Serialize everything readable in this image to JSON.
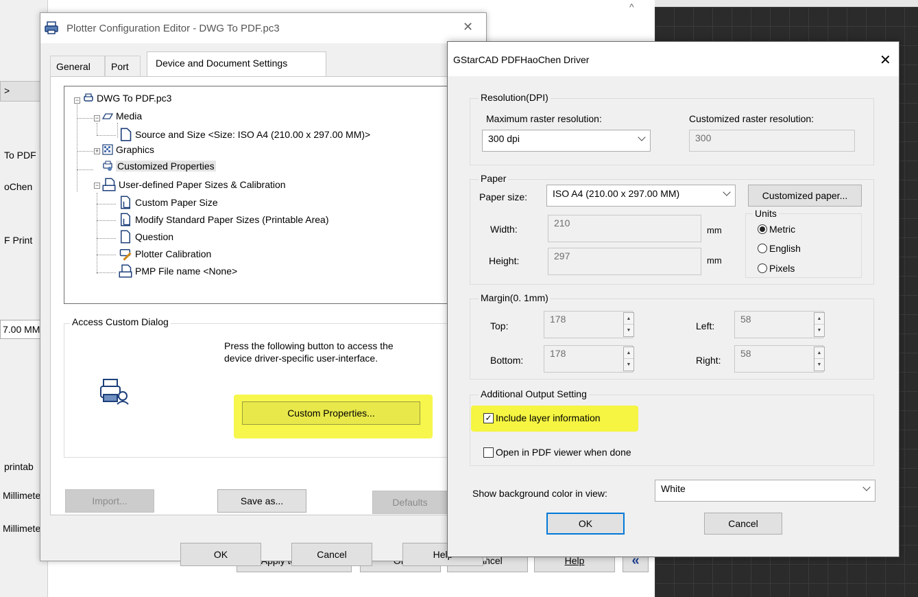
{
  "background_app": {
    "left_fragments": [
      ">",
      "To PDF",
      "oChen",
      "F Print",
      "7.00 MM",
      "printab",
      "Millimete",
      "Millimete"
    ],
    "bottom_buttons": {
      "apply": "Apply to Layout",
      "ok": "OK",
      "cancel": "Cancel",
      "help": "Help",
      "collapse": "«"
    },
    "caret": "^"
  },
  "plotter_editor": {
    "title": "Plotter Configuration Editor - DWG To PDF.pc3",
    "close": "✕",
    "tabs": [
      "General",
      "Port",
      "Device and Document Settings"
    ],
    "tree": {
      "root": "DWG To PDF.pc3",
      "media": "Media",
      "source_size": "Source and Size <Size: ISO A4 (210.00 x 297.00 MM)>",
      "graphics": "Graphics",
      "custom_props": "Customized Properties",
      "user_paper": "User-defined Paper Sizes & Calibration",
      "custom_paper": "Custom Paper Size",
      "modify_std": "Modify Standard Paper Sizes (Printable Area)",
      "question": "Question",
      "calibration": "Plotter Calibration",
      "pmp": "PMP File name <None>"
    },
    "access": {
      "title": "Access Custom Dialog",
      "desc1": "Press the following button to access the",
      "desc2": "device driver-specific user-interface.",
      "button": "Custom Properties..."
    },
    "import": "Import...",
    "save_as": "Save as...",
    "defaults": "Defaults",
    "ok": "OK",
    "cancel": "Cancel",
    "help": "Help"
  },
  "driver_dialog": {
    "title": "GStarCAD PDFHaoChen Driver",
    "close": "✕",
    "resolution": {
      "group": "Resolution(DPI)",
      "max_label": "Maximum raster resolution:",
      "max_value": "300  dpi",
      "custom_label": "Customized raster resolution:",
      "custom_value": "300"
    },
    "paper": {
      "group": "Paper",
      "size_label": "Paper size:",
      "size_value": "ISO A4 (210.00 x 297.00 MM)",
      "customized_button": "Customized paper...",
      "width_label": "Width:",
      "width_value": "210",
      "height_label": "Height:",
      "height_value": "297",
      "unit": "mm",
      "units_group": "Units",
      "units": [
        "Metric",
        "English",
        "Pixels"
      ],
      "selected_unit": "Metric"
    },
    "margin": {
      "group": "Margin(0. 1mm)",
      "top_label": "Top:",
      "top_value": "178",
      "bottom_label": "Bottom:",
      "bottom_value": "178",
      "left_label": "Left:",
      "left_value": "58",
      "right_label": "Right:",
      "right_value": "58"
    },
    "output": {
      "group": "Additional Output Setting",
      "include_layer": "Include layer information",
      "include_layer_checked": true,
      "open_viewer": "Open in PDF viewer when done",
      "open_viewer_checked": false
    },
    "bg_label": "Show background color in view:",
    "bg_value": "White",
    "ok": "OK",
    "cancel": "Cancel"
  },
  "colors": {
    "highlight": "#f5f542",
    "dialog_bg": "#f0f0f0",
    "cad_bg": "#2b2b2b",
    "focus_border": "#0078d7"
  }
}
